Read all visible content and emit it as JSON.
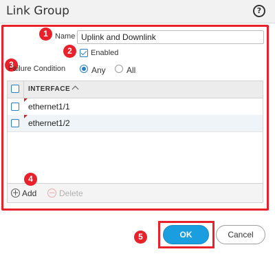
{
  "dialog": {
    "title": "Link Group",
    "help_icon": "?"
  },
  "form": {
    "name_label": "Name",
    "name_value": "Uplink and Downlink",
    "enabled_label": "Enabled",
    "enabled_checked": true,
    "failure_condition_label": "Failure Condition",
    "failure_options": [
      {
        "label": "Any",
        "selected": true
      },
      {
        "label": "All",
        "selected": false
      }
    ]
  },
  "grid": {
    "column_header": "INTERFACE",
    "rows": [
      {
        "interface": "ethernet1/1"
      },
      {
        "interface": "ethernet1/2"
      }
    ],
    "footer": {
      "add_label": "Add",
      "add_icon": "+",
      "delete_label": "Delete",
      "delete_icon": "−"
    }
  },
  "buttons": {
    "ok_label": "OK",
    "cancel_label": "Cancel"
  },
  "annotations": {
    "badges": [
      "1",
      "2",
      "3",
      "4",
      "5"
    ]
  },
  "colors": {
    "annotation_red": "#e8212b",
    "accent_blue": "#1a9ee0",
    "row_alt": "#eef4f8"
  }
}
